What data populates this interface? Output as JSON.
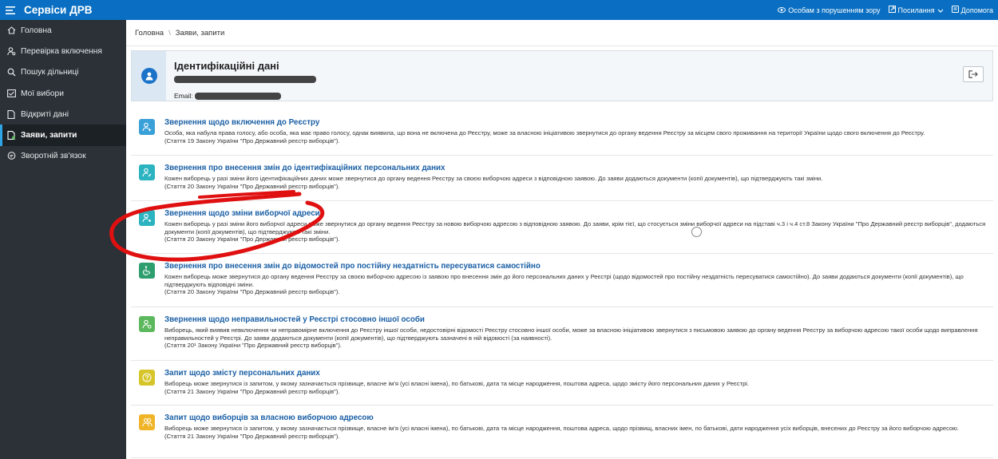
{
  "header": {
    "app_title": "Сервіси ДРВ",
    "links": [
      {
        "label": "Особам з порушенням зору",
        "icon": "eye-icon"
      },
      {
        "label": "Посилання",
        "icon": "external-link-icon"
      },
      {
        "label": "Допомога",
        "icon": "help-icon"
      }
    ]
  },
  "sidebar": {
    "items": [
      {
        "label": "Головна",
        "icon": "home-icon"
      },
      {
        "label": "Перевірка включення",
        "icon": "user-search-icon"
      },
      {
        "label": "Пошук дільниці",
        "icon": "search-icon"
      },
      {
        "label": "Мої вибори",
        "icon": "ballot-icon"
      },
      {
        "label": "Відкриті дані",
        "icon": "open-data-icon"
      },
      {
        "label": "Заяви, запити",
        "icon": "document-icon",
        "active": true
      },
      {
        "label": "Зворотній зв'язок",
        "icon": "feedback-icon"
      }
    ]
  },
  "breadcrumb": {
    "home": "Головна",
    "current": "Заяви, запити"
  },
  "identity": {
    "title": "Ідентифікаційні дані",
    "email_label": "Email:"
  },
  "requests": [
    {
      "title": "Звернення щодо включення до Реєстру",
      "desc": "Особа, яка набула права голосу, або особа, яка має право голосу, однак виявила, що вона не включена до Реєстру, може за власною ініціативою звернутися до органу ведення Реєстру за місцем свого проживання на території України щодо свого включення до Реєстру.",
      "law": "(Стаття 19 Закону України \"Про Державний реєстр виборців\").",
      "icon": "user-plus-icon",
      "color": "#3aa0d8"
    },
    {
      "title": "Звернення про внесення змін до ідентифікаційних персональних даних",
      "desc": "Кожен виборець у разі зміни його ідентифікаційних даних може звернутися до органу ведення Реєстру за своєю виборчою адреси з відповідною заявою. До заяви додаються документи (копії документів), що підтверджують такі зміни.",
      "law": "(Стаття 20 Закону України \"Про Державний реєстр виборців\").",
      "icon": "user-edit-icon",
      "color": "#2bb3c0"
    },
    {
      "title": "Звернення щодо зміни виборчої адреси",
      "desc": "Кожен виборець у разі зміни його виборчої адреси може звернутися до органу ведення Реєстру за новою виборчою адресою з відповідною заявою. До заяви, крім тієї, що стосується зміни виборчої адреси на підставі ч.3 і ч.4 ст.8 Закону України \"Про Державний реєстр виборців\", додаються документи (копії документів), що підтверджують такі зміни.",
      "law": "(Стаття 20 Закону України \"Про Державний реєстр виборців\").",
      "icon": "user-location-icon",
      "color": "#2bb3c0"
    },
    {
      "title": "Звернення про внесення змін до відомостей про постійну нездатність пересуватися самостійно",
      "desc": "Кожен виборець може звернутися до органу ведення Реєстру за своєю виборчою адресою із заявою про внесення змін до його персональних даних у Реєстрі (щодо відомостей про постійну нездатність пересуватися самостійно). До заяви додаються документи (копії документів), що підтверджують відповідні зміни.",
      "law": "(Стаття 20 Закону України \"Про Державний реєстр виборців\").",
      "icon": "wheelchair-icon",
      "color": "#2e9e6e"
    },
    {
      "title": "Звернення щодо неправильностей у Реєстрі стосовно іншої особи",
      "desc": "Виборець, який виявив невключення чи неправомірне включення до Реєстру іншої особи, недостовірні відомості Реєстру стосовно іншої особи, може за власною ініціативою звернутися з письмовою заявою до органу ведення Реєстру за виборчою адресою такої особи щодо виправлення неправильностей у Реєстрі. До заяви додаються документи (копії документів), що підтверджують зазначені в ній відомості (за наявності).",
      "law": "(Стаття 20¹ Закону України \"Про Державний реєстр виборців\").",
      "icon": "user-report-icon",
      "color": "#5cb85c"
    },
    {
      "title": "Запит щодо змісту персональних даних",
      "desc": "Виборець може звернутися із запитом, у якому зазначається прізвище, власне ім'я (усі власні імена), по батькові, дата та місце народження, поштова адреса, щодо змісту його персональних даних у Реєстрі.",
      "law": "(Стаття 21 Закону України \"Про Державний реєстр виборців\").",
      "icon": "question-icon",
      "color": "#d6c52a"
    },
    {
      "title": "Запит щодо виборців за власною виборчою адресою",
      "desc": "Виборець може звернутися із запитом, у якому зазначається прізвище, власне ім'я (усі власні імена), по батькові, дата та місце народження, поштова адреса, щодо прізвищ, власних імен, по батькові, дати народження усіх виборців, внесених до Реєстру за його виборчою адресою.",
      "law": "(Стаття 21 Закону України \"Про Державний реєстр виборців\").",
      "icon": "users-icon",
      "color": "#f0b429"
    }
  ]
}
